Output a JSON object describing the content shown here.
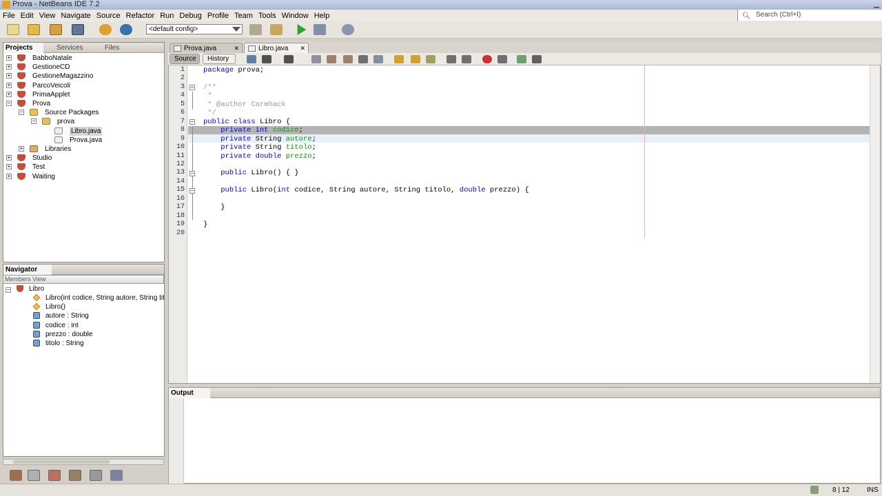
{
  "window": {
    "title": "Prova - NetBeans IDE 7.2"
  },
  "menu": [
    "File",
    "Edit",
    "View",
    "Navigate",
    "Source",
    "Refactor",
    "Run",
    "Debug",
    "Profile",
    "Team",
    "Tools",
    "Window",
    "Help"
  ],
  "search": {
    "placeholder": "Search (Ctrl+I)"
  },
  "toolbar": {
    "config": "<default config>"
  },
  "projects_panel": {
    "tabs": [
      "Projects",
      "Services",
      "Files"
    ],
    "tree": [
      {
        "label": "BabboNatale",
        "level": 0,
        "expander": "+"
      },
      {
        "label": "GestioneCD",
        "level": 0,
        "expander": "+"
      },
      {
        "label": "GestioneMagazzino",
        "level": 0,
        "expander": "+"
      },
      {
        "label": "ParcoVeicoli",
        "level": 0,
        "expander": "+"
      },
      {
        "label": "PrimaApplet",
        "level": 0,
        "expander": "+"
      },
      {
        "label": "Prova",
        "level": 0,
        "expander": "-"
      },
      {
        "label": "Source Packages",
        "level": 1,
        "expander": "-"
      },
      {
        "label": "prova",
        "level": 2,
        "expander": "-"
      },
      {
        "label": "Libro.java",
        "level": 3,
        "expander": "",
        "selected": true
      },
      {
        "label": "Prova.java",
        "level": 3,
        "expander": ""
      },
      {
        "label": "Libraries",
        "level": 1,
        "expander": "+"
      },
      {
        "label": "Studio",
        "level": 0,
        "expander": "+"
      },
      {
        "label": "Test",
        "level": 0,
        "expander": "+"
      },
      {
        "label": "Waiting",
        "level": 0,
        "expander": "+"
      }
    ]
  },
  "navigator": {
    "title": "Navigator",
    "view": "Members View",
    "root": "Libro",
    "members": [
      {
        "label": "Libro(int codice, String autore, String titolo, double prezzo)",
        "kind": "ctor"
      },
      {
        "label": "Libro()",
        "kind": "ctor"
      },
      {
        "label": "autore : String",
        "kind": "field"
      },
      {
        "label": "codice : int",
        "kind": "field"
      },
      {
        "label": "prezzo : double",
        "kind": "field"
      },
      {
        "label": "titolo : String",
        "kind": "field"
      }
    ]
  },
  "editor": {
    "tabs": [
      "Prova.java",
      "Libro.java"
    ],
    "active_tab": "Libro.java",
    "view_buttons": [
      "Source",
      "History"
    ],
    "lines": [
      "package prova;",
      "",
      "/**",
      " *",
      " * @author Carmhack",
      " */",
      "public class Libro {",
      "    private int codice;",
      "    private String autore;",
      "    private String titolo;",
      "    private double prezzo;",
      "",
      "    public Libro() { }",
      "",
      "    public Libro(int codice, String autore, String titolo, double prezzo) {",
      "",
      "    }",
      "",
      "}",
      ""
    ]
  },
  "output": {
    "title": "Output"
  },
  "status": {
    "position": "8 | 12",
    "mode": "INS"
  }
}
